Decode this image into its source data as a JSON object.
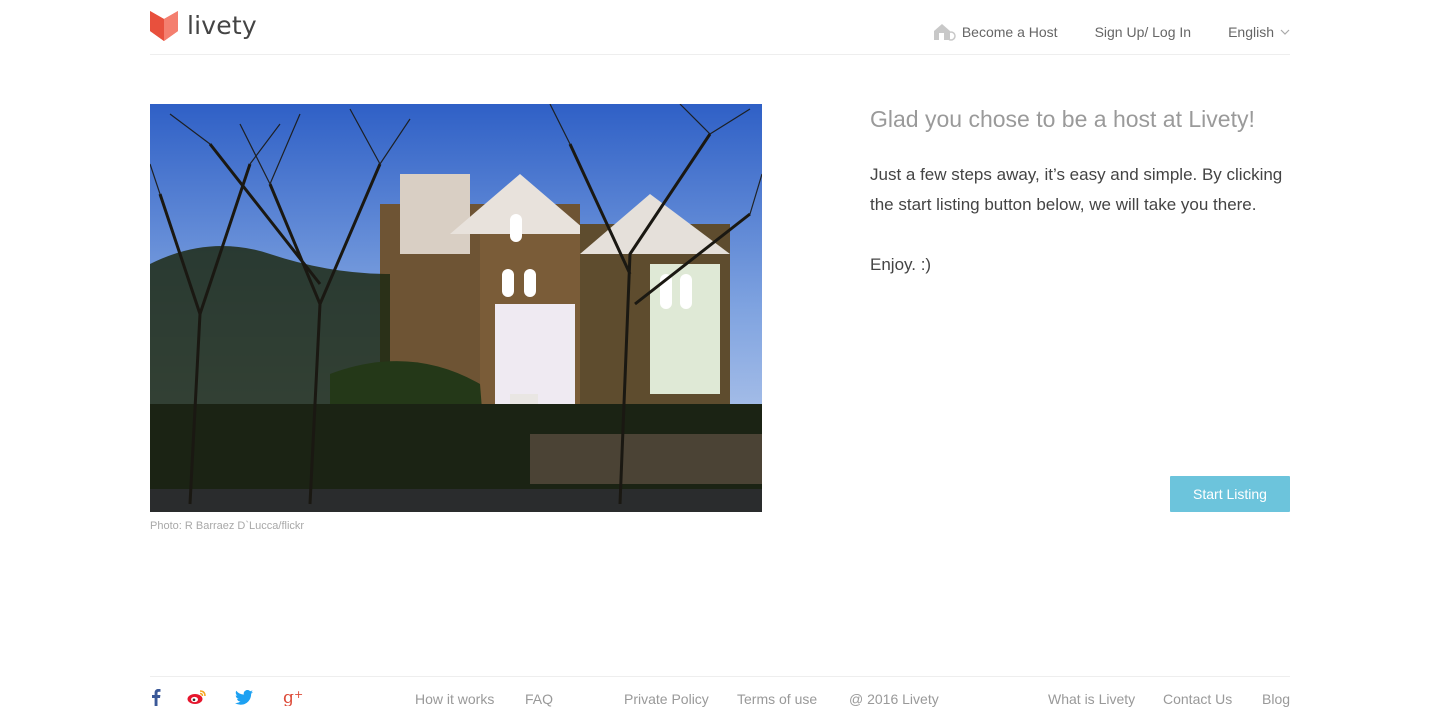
{
  "brand": {
    "name": "livety",
    "accent_color": "#f0624f",
    "button_color": "#6cc4dc"
  },
  "nav": {
    "become_host": "Become a Host",
    "become_host_icon": "house-icon",
    "signup_login": "Sign Up/ Log In",
    "language": "English",
    "language_icon": "chevron-down-icon"
  },
  "hero": {
    "photo_alt": "Victorian brick houses behind bare trees",
    "caption": "Photo: R Barraez D`Lucca/flickr"
  },
  "welcome": {
    "title": "Glad you chose to be a host at Livety!",
    "body": "Just a few steps away, it’s easy and simple. By clicking the start listing button below, we will take you there.",
    "enjoy": "Enjoy. :)",
    "cta": "Start Listing"
  },
  "footer": {
    "social": [
      "facebook-icon",
      "weibo-icon",
      "twitter-icon",
      "google-plus-icon"
    ],
    "how_it_works": "How it works",
    "faq": "FAQ",
    "private_policy": "Private Policy",
    "terms": "Terms of use",
    "copyright": "@ 2016 Livety",
    "what_is": "What is Livety",
    "contact": "Contact Us",
    "blog": "Blog"
  }
}
